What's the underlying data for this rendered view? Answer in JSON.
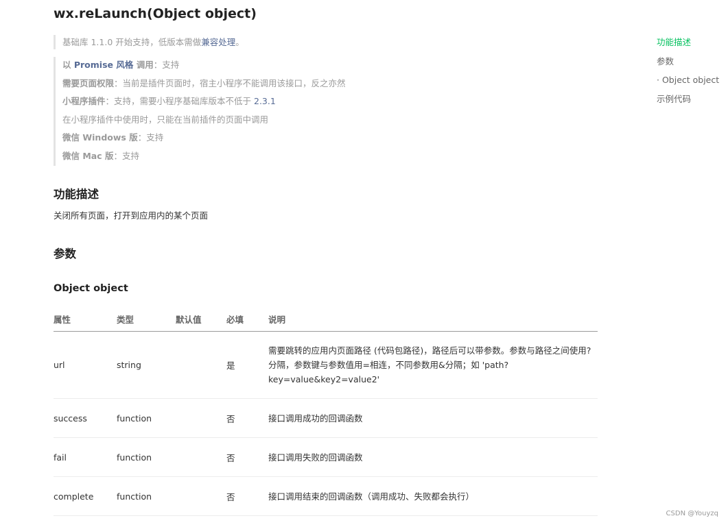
{
  "page": {
    "title": "wx.reLaunch(Object object)"
  },
  "support": {
    "base_prefix": "基础库 1.1.0 开始支持，低版本需做",
    "compat_link": "兼容处理",
    "base_suffix": "。",
    "promise_prefix": "以 ",
    "promise_link": "Promise 风格",
    "promise_mid": " 调用",
    "promise_value": "：支持",
    "perm_label": "需要页面权限",
    "perm_value": "：当前是插件页面时，宿主小程序不能调用该接口，反之亦然",
    "plugin_label": "小程序插件",
    "plugin_value": "：支持，需要小程序基础库版本不低于 ",
    "plugin_version": "2.3.1",
    "plugin_note": "在小程序插件中使用时，只能在当前插件的页面中调用",
    "windows_label": "微信 Windows 版",
    "windows_value": "：支持",
    "mac_label": "微信 Mac 版",
    "mac_value": "：支持"
  },
  "sections": {
    "feature_heading": "功能描述",
    "feature_desc": "关闭所有页面，打开到应用内的某个页面",
    "params_heading": "参数",
    "object_heading": "Object object"
  },
  "table": {
    "headers": [
      "属性",
      "类型",
      "默认值",
      "必填",
      "说明"
    ],
    "rows": [
      {
        "name": "url",
        "type": "string",
        "default": "",
        "required": "是",
        "desc": [
          "需要跳转的应用内页面路径 (代码包路径)，路径后可以带参数。参数与路径之间使用?",
          "分隔，参数键与参数值用=相连，不同参数用&分隔；如 'path?",
          "key=value&key2=value2'"
        ]
      },
      {
        "name": "success",
        "type": "function",
        "default": "",
        "required": "否",
        "desc": [
          "接口调用成功的回调函数"
        ]
      },
      {
        "name": "fail",
        "type": "function",
        "default": "",
        "required": "否",
        "desc": [
          "接口调用失败的回调函数"
        ]
      },
      {
        "name": "complete",
        "type": "function",
        "default": "",
        "required": "否",
        "desc": [
          "接口调用结束的回调函数（调用成功、失败都会执行）"
        ]
      }
    ]
  },
  "toc": {
    "items": [
      "功能描述",
      "参数",
      "· Object object",
      "示例代码"
    ],
    "active_color": "#07c160"
  },
  "watermark": "CSDN @Youyzq"
}
